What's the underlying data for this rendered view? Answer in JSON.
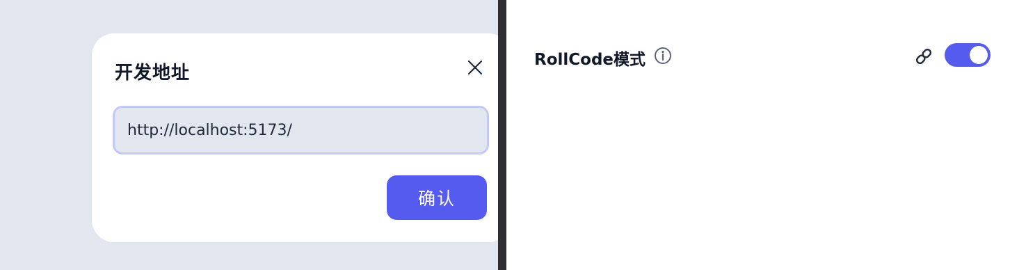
{
  "dialog": {
    "title": "开发地址",
    "url_value": "http://localhost:5173/",
    "confirm_label": "确认",
    "close_icon": "close-icon"
  },
  "settings": {
    "rollcode_label": "RollCode模式",
    "info_icon": "info-icon",
    "link_icon": "link-icon",
    "rollcode_enabled": true
  },
  "colors": {
    "accent": "#565bf0",
    "backdrop": "#e2e6ee",
    "input_border": "#c4c8f6",
    "divider": "#2f2f33",
    "text": "#111827"
  }
}
